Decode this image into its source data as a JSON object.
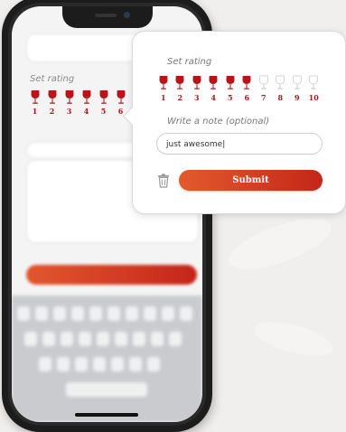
{
  "phone": {
    "rating_label": "Set rating",
    "visible_numbers": [
      "1",
      "2",
      "3",
      "4",
      "5",
      "6"
    ]
  },
  "popover": {
    "rating_label": "Set rating",
    "rating_value": 6,
    "rating_max": 10,
    "glass_numbers": [
      "1",
      "2",
      "3",
      "4",
      "5",
      "6",
      "7",
      "8",
      "9",
      "10"
    ],
    "note_label": "Write a note (optional)",
    "note_value": "just awesome|",
    "submit_label": "Submit",
    "delete_icon": "trash-icon",
    "rating_icon": "wine-glass-icon"
  },
  "colors": {
    "accent": "#c4261a",
    "accent_light": "#e35a2d",
    "glass_filled": "#b8141a",
    "glass_empty": "#cfcfcf"
  }
}
